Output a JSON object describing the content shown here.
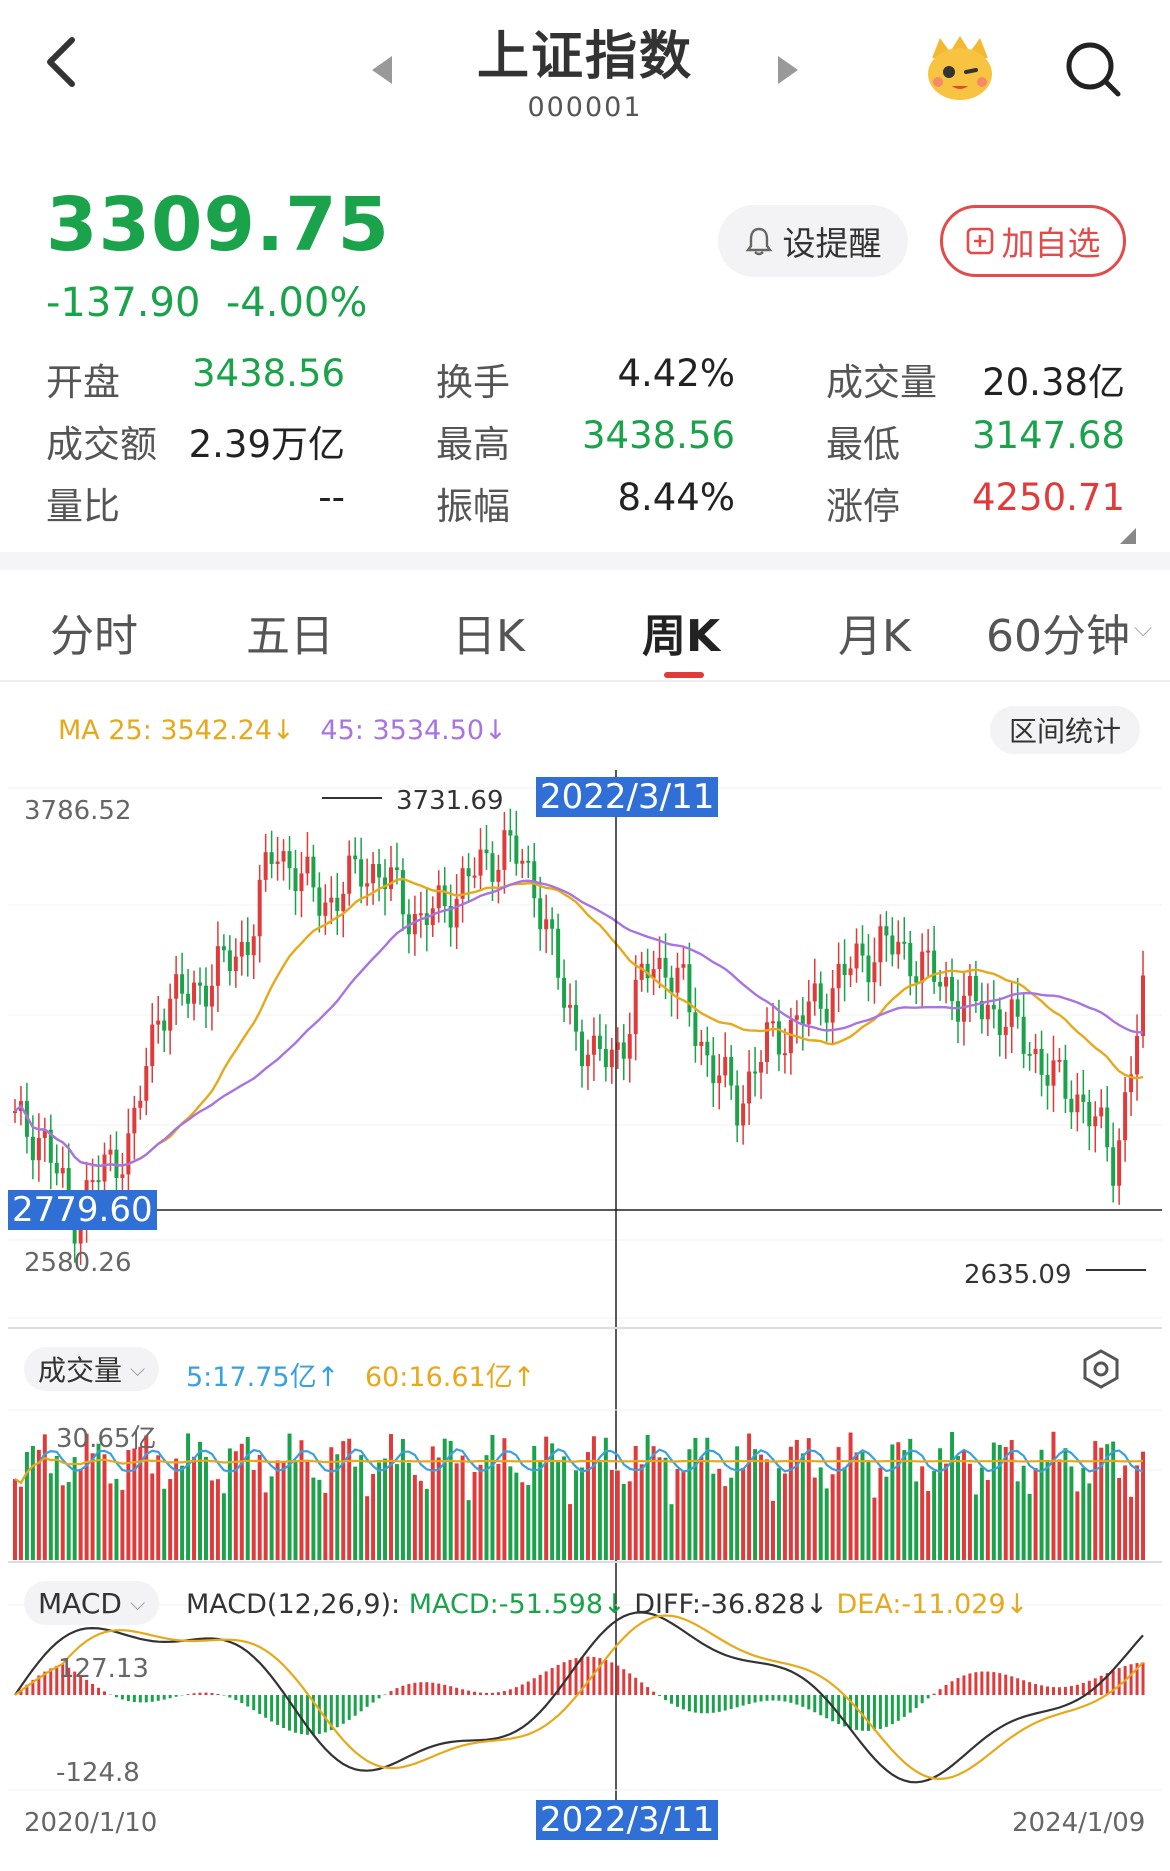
{
  "header": {
    "title": "上证指数",
    "code": "000001",
    "back_icon": "back-chevron-icon",
    "prev_icon": "caret-left-icon",
    "next_icon": "caret-right-icon",
    "mascot_icon": "mascot-icon",
    "search_icon": "search-icon"
  },
  "quote": {
    "price": "3309.75",
    "change": "-137.90",
    "change_pct": "-4.00%",
    "remind_label": "设提醒",
    "add_label": "加自选"
  },
  "stats": [
    {
      "label": "开盘",
      "value": "3438.56",
      "tone": "green"
    },
    {
      "label": "换手",
      "value": "4.42%",
      "tone": "dark"
    },
    {
      "label": "成交量",
      "value": "20.38亿",
      "tone": "dark"
    },
    {
      "label": "成交额",
      "value": "2.39万亿",
      "tone": "dark"
    },
    {
      "label": "最高",
      "value": "3438.56",
      "tone": "green"
    },
    {
      "label": "最低",
      "value": "3147.68",
      "tone": "green"
    },
    {
      "label": "量比",
      "value": "--",
      "tone": "dark"
    },
    {
      "label": "振幅",
      "value": "8.44%",
      "tone": "dark"
    },
    {
      "label": "涨停",
      "value": "4250.71",
      "tone": "red"
    }
  ],
  "tabs": [
    {
      "label": "分时",
      "active": false
    },
    {
      "label": "五日",
      "active": false
    },
    {
      "label": "日K",
      "active": false
    },
    {
      "label": "周K",
      "active": true
    },
    {
      "label": "月K",
      "active": false
    },
    {
      "label": "60分钟",
      "active": false
    }
  ],
  "ma": {
    "ma25": "MA 25: 3542.24↓",
    "ma45": "45: 3534.50↓",
    "range_label": "区间统计"
  },
  "kline": {
    "top_label": "3786.52",
    "bottom_label": "2580.26",
    "high_marker": "3731.69",
    "low_marker": "2635.09",
    "crosshair_price": "2779.60",
    "crosshair_date": "2022/3/11"
  },
  "volume": {
    "label": "成交量",
    "ma5": "5:17.75亿↑",
    "ma60": "60:16.61亿↑",
    "top_label": "30.65亿",
    "settings_icon": "hexagon-settings-icon"
  },
  "macd": {
    "label": "MACD",
    "params": "MACD(12,26,9):",
    "macd": "MACD:-51.598↓",
    "diff": "DIFF:-36.828↓",
    "dea": "DEA:-11.029↓",
    "top_label": "127.13",
    "bottom_label": "-124.8"
  },
  "dates": {
    "start": "2020/1/10",
    "crosshair": "2022/3/11",
    "end": "2024/1/09"
  },
  "colors": {
    "up": "#e03a3a",
    "down": "#1aa34a",
    "ma25": "#e7a91c",
    "ma45": "#a774e0",
    "vol_ma5": "#3aa0e0",
    "flag": "#2f6fd6"
  },
  "chart_data": {
    "type": "candlestick",
    "price_range": [
      2580.26,
      3786.52
    ],
    "series_shape": "weekly closes 2020/1/10 – 2024/1/09 (approx.)",
    "closes_sample": [
      3000,
      2960,
      2760,
      2880,
      2950,
      3300,
      3320,
      3380,
      3450,
      3700,
      3600,
      3550,
      3650,
      3600,
      3500,
      3560,
      3640,
      3700,
      3600,
      3300,
      3150,
      3200,
      3420,
      3350,
      3150,
      3050,
      3200,
      3250,
      3320,
      3400,
      3450,
      3420,
      3350,
      3300,
      3280,
      3200,
      3100,
      3050,
      2900,
      3309.75
    ]
  }
}
